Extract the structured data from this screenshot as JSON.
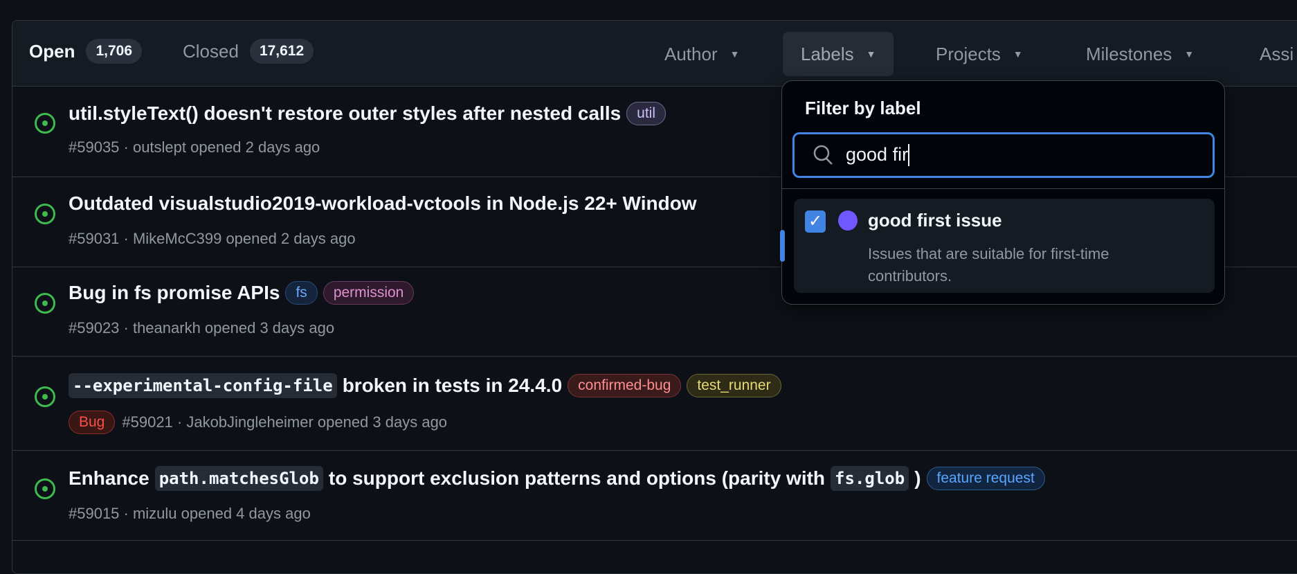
{
  "header": {
    "open_label": "Open",
    "open_count": "1,706",
    "closed_label": "Closed",
    "closed_count": "17,612",
    "filters": [
      "Author",
      "Labels",
      "Projects",
      "Milestones",
      "Assi"
    ]
  },
  "issues": [
    {
      "title": "util.styleText() doesn't restore outer styles after nested calls",
      "labels": [
        {
          "name": "util",
          "color": "#b8b2e8"
        }
      ],
      "meta": "#59035 · outslept opened 2 days ago"
    },
    {
      "title": "Outdated visualstudio2019-workload-vctools in Node.js 22+ Window",
      "labels": [],
      "meta": "#59031 · MikeMcC399 opened 2 days ago"
    },
    {
      "title": "Bug in fs promise APIs",
      "labels": [
        {
          "name": "fs",
          "color": "#6ea8ff"
        },
        {
          "name": "permission",
          "color": "#e08fd0"
        }
      ],
      "meta": "#59023 · theanarkh opened 3 days ago"
    },
    {
      "title_code": "--experimental-config-file",
      "title_rest": "broken in tests in 24.4.0",
      "labels": [
        {
          "name": "confirmed-bug",
          "color": "#ff8f8f"
        },
        {
          "name": "test_runner",
          "color": "#e6db74"
        }
      ],
      "pre_label": {
        "name": "Bug",
        "color": "#f85149"
      },
      "meta": "#59021 · JakobJingleheimer opened 3 days ago"
    },
    {
      "t1": "Enhance",
      "c1": "path.matchesGlob",
      "t2": "to support exclusion patterns and options (parity with",
      "c2": "fs.glob",
      "t3": ")",
      "labels": [
        {
          "name": "feature request",
          "color": "#58a6ff"
        }
      ],
      "meta": "#59015 · mizulu opened 4 days ago"
    }
  ],
  "dropdown": {
    "title": "Filter by label",
    "search_value": "good fir",
    "item": {
      "name": "good first issue",
      "description": "Issues that are suitable for first-time contributors.",
      "color": "#7057ff",
      "checked": true
    }
  }
}
